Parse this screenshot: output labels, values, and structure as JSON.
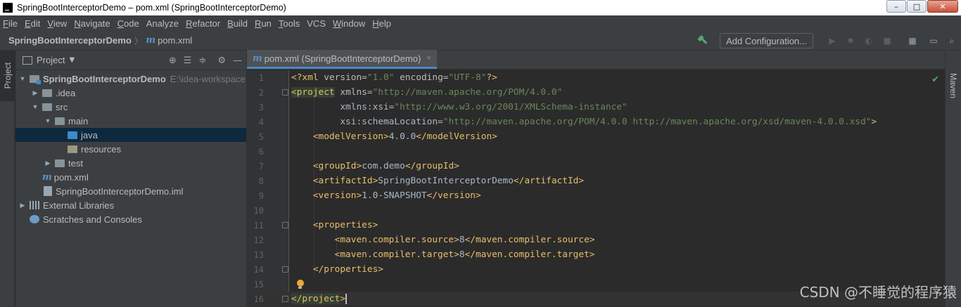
{
  "window": {
    "title": "SpringBootInterceptorDemo – pom.xml (SpringBootInterceptorDemo)",
    "buttons": [
      "–",
      "□",
      "✕"
    ]
  },
  "menu": [
    {
      "label": "File",
      "u": "F",
      "rest": "ile"
    },
    {
      "label": "Edit",
      "u": "E",
      "rest": "dit"
    },
    {
      "label": "View",
      "u": "V",
      "rest": "iew"
    },
    {
      "label": "Navigate",
      "u": "N",
      "rest": "avigate"
    },
    {
      "label": "Code",
      "u": "C",
      "rest": "ode"
    },
    {
      "label": "Analyze",
      "u": "",
      "rest": "Analyze"
    },
    {
      "label": "Refactor",
      "u": "R",
      "rest": "efactor"
    },
    {
      "label": "Build",
      "u": "B",
      "rest": "uild"
    },
    {
      "label": "Run",
      "u": "R",
      "rest": "un"
    },
    {
      "label": "Tools",
      "u": "T",
      "rest": "ools"
    },
    {
      "label": "VCS",
      "u": "",
      "rest": "VCS"
    },
    {
      "label": "Window",
      "u": "W",
      "rest": "indow"
    },
    {
      "label": "Help",
      "u": "H",
      "rest": "elp"
    }
  ],
  "breadcrumb": {
    "project": "SpringBootInterceptorDemo",
    "file_icon": "m",
    "file": "pom.xml"
  },
  "toolbar": {
    "add_configuration": "Add Configuration..."
  },
  "side_tabs": {
    "left": "Project",
    "right": "Maven"
  },
  "project_panel": {
    "title": "Project",
    "tree": [
      {
        "label": "SpringBootInterceptorDemo",
        "path": "E:\\idea-workspace",
        "depth": 0,
        "arrow": "▼",
        "icon": "module-folder",
        "bold": true
      },
      {
        "label": ".idea",
        "depth": 1,
        "arrow": "▶",
        "icon": "folder"
      },
      {
        "label": "src",
        "depth": 1,
        "arrow": "▼",
        "icon": "folder"
      },
      {
        "label": "main",
        "depth": 2,
        "arrow": "▼",
        "icon": "folder"
      },
      {
        "label": "java",
        "depth": 3,
        "arrow": "",
        "icon": "source-folder",
        "selected": true
      },
      {
        "label": "resources",
        "depth": 3,
        "arrow": "",
        "icon": "resources-folder"
      },
      {
        "label": "test",
        "depth": 2,
        "arrow": "▶",
        "icon": "folder"
      },
      {
        "label": "pom.xml",
        "depth": 1,
        "arrow": "",
        "icon": "maven-file"
      },
      {
        "label": "SpringBootInterceptorDemo.iml",
        "depth": 1,
        "arrow": "",
        "icon": "iml-file"
      },
      {
        "label": "External Libraries",
        "depth": 0,
        "arrow": "▶",
        "icon": "libraries"
      },
      {
        "label": "Scratches and Consoles",
        "depth": 0,
        "arrow": "",
        "icon": "scratches"
      }
    ]
  },
  "editor": {
    "tab_label": "pom.xml (SpringBootInterceptorDemo)",
    "tab_close": "×",
    "line_numbers": [
      "1",
      "2",
      "3",
      "4",
      "5",
      "6",
      "7",
      "8",
      "9",
      "10",
      "11",
      "12",
      "13",
      "14",
      "15",
      "16"
    ],
    "lines": [
      "<?xml version=\"1.0\" encoding=\"UTF-8\"?>",
      "<project xmlns=\"http://maven.apache.org/POM/4.0.0\"",
      "         xmlns:xsi=\"http://www.w3.org/2001/XMLSchema-instance\"",
      "         xsi:schemaLocation=\"http://maven.apache.org/POM/4.0.0 http://maven.apache.org/xsd/maven-4.0.0.xsd\">",
      "    <modelVersion>4.0.0</modelVersion>",
      "",
      "    <groupId>com.demo</groupId>",
      "    <artifactId>SpringBootInterceptorDemo</artifactId>",
      "    <version>1.0-SNAPSHOT</version>",
      "",
      "    <properties>",
      "        <maven.compiler.source>8</maven.compiler.source>",
      "        <maven.compiler.target>8</maven.compiler.target>",
      "    </properties>",
      "",
      "</project>"
    ]
  },
  "watermark": "CSDN @不睡觉的程序猿",
  "colors": {
    "background": "#2b2b2b",
    "tag": "#e8bf6a",
    "string": "#6a8759",
    "namespace": "#9876aa",
    "selection": "#0d293e"
  }
}
